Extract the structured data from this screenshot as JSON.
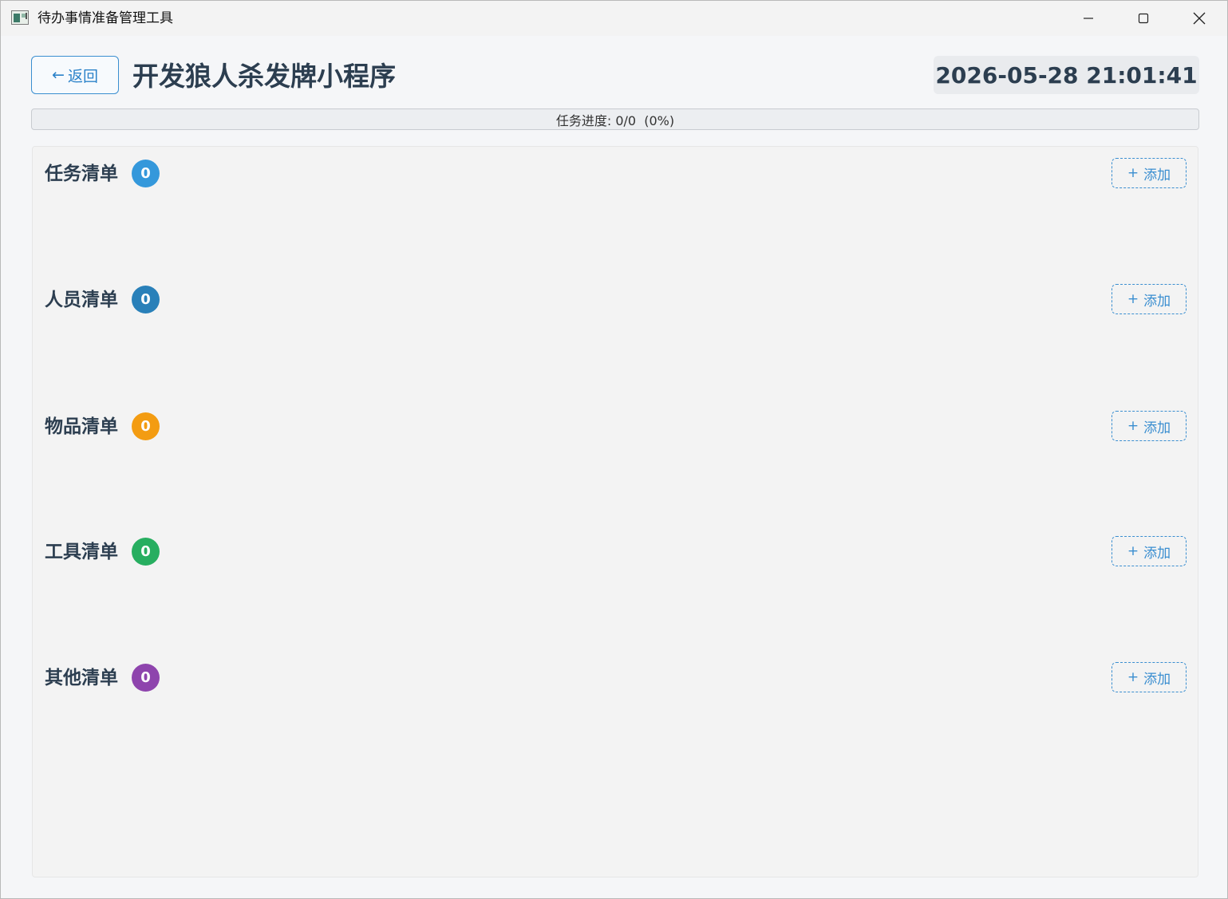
{
  "window": {
    "title": "待办事情准备管理工具"
  },
  "header": {
    "back_arrow": "←",
    "back_label": "返回",
    "title": "开发狼人杀发牌小程序",
    "datetime": "2026-05-28 21:01:41"
  },
  "progress": {
    "label": "任务进度: 0/0  (0%)",
    "fraction": 0
  },
  "add_button": {
    "plus": "+",
    "label": "添加"
  },
  "sections": [
    {
      "title": "任务清单",
      "count": "0",
      "badge_color": "#3498db"
    },
    {
      "title": "人员清单",
      "count": "0",
      "badge_color": "#2980b9"
    },
    {
      "title": "物品清单",
      "count": "0",
      "badge_color": "#f39c12"
    },
    {
      "title": "工具清单",
      "count": "0",
      "badge_color": "#27ae60"
    },
    {
      "title": "其他清单",
      "count": "0",
      "badge_color": "#8e44ad"
    }
  ],
  "colors": {
    "accent": "#3a8ed0",
    "title_text": "#2c3e50"
  },
  "icons": {
    "app": "app-window-icon",
    "minimize": "minimize-icon",
    "maximize": "maximize-icon",
    "close": "close-icon",
    "back": "arrow-left-icon"
  }
}
